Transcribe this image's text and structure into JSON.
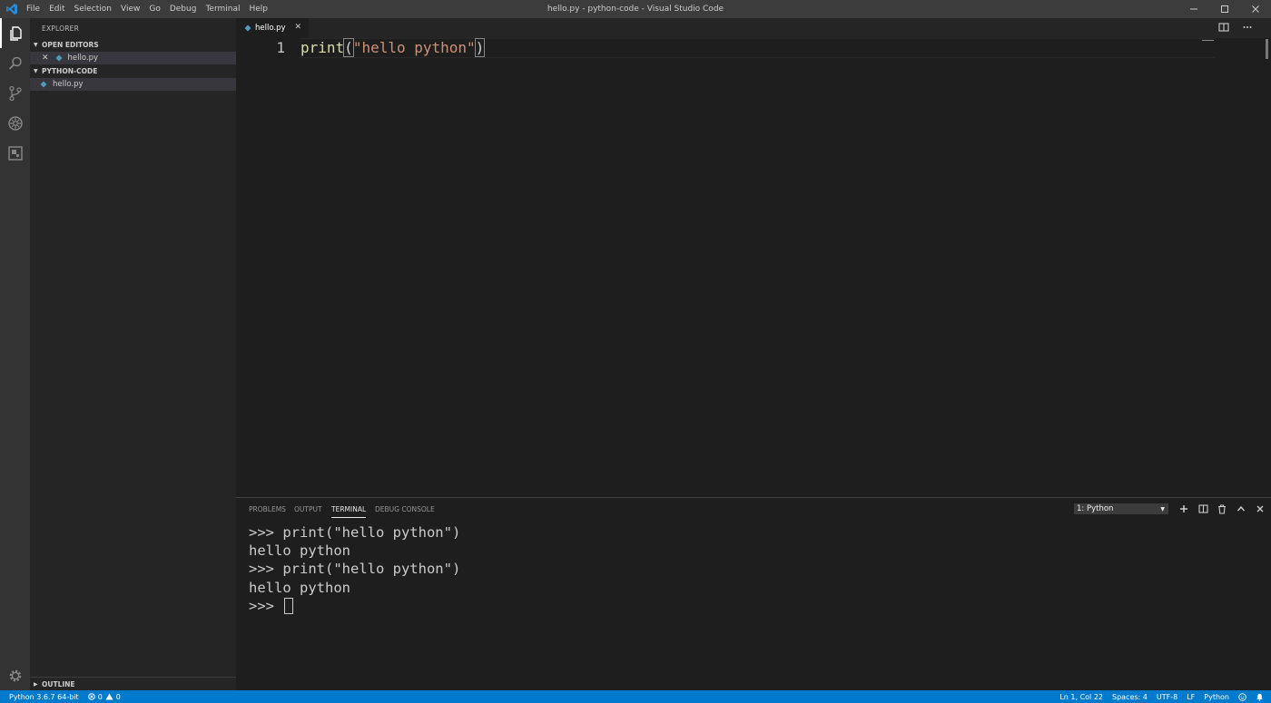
{
  "window": {
    "title": "hello.py - python-code - Visual Studio Code",
    "menu": [
      "File",
      "Edit",
      "Selection",
      "View",
      "Go",
      "Debug",
      "Terminal",
      "Help"
    ]
  },
  "activity_bar": {
    "items": [
      "explorer-icon",
      "search-icon",
      "source-control-icon",
      "debug-icon",
      "extensions-icon"
    ],
    "bottom": "gear-icon"
  },
  "sidebar": {
    "title": "EXPLORER",
    "open_editors": {
      "label": "OPEN EDITORS",
      "files": [
        "hello.py"
      ]
    },
    "folder": {
      "label": "PYTHON-CODE",
      "files": [
        "hello.py"
      ]
    },
    "outline_label": "OUTLINE"
  },
  "editor": {
    "tab_label": "hello.py",
    "line_number": "1",
    "code": {
      "fn": "print",
      "open": "(",
      "str": "\"hello python\"",
      "close": ")"
    }
  },
  "panel": {
    "tabs": [
      "PROBLEMS",
      "OUTPUT",
      "TERMINAL",
      "DEBUG CONSOLE"
    ],
    "active_tab": "TERMINAL",
    "terminal_select": "1: Python",
    "terminal_lines": [
      ">>> print(\"hello python\")",
      "hello python",
      ">>> print(\"hello python\")",
      "hello python",
      ">>> "
    ]
  },
  "status_bar": {
    "python_version": "Python 3.6.7 64-bit",
    "errors": "0",
    "warnings": "0",
    "position": "Ln 1, Col 22",
    "spaces": "Spaces: 4",
    "encoding": "UTF-8",
    "eol": "LF",
    "language": "Python"
  },
  "colors": {
    "accent": "#007acc",
    "python_icon": "#519aba"
  }
}
